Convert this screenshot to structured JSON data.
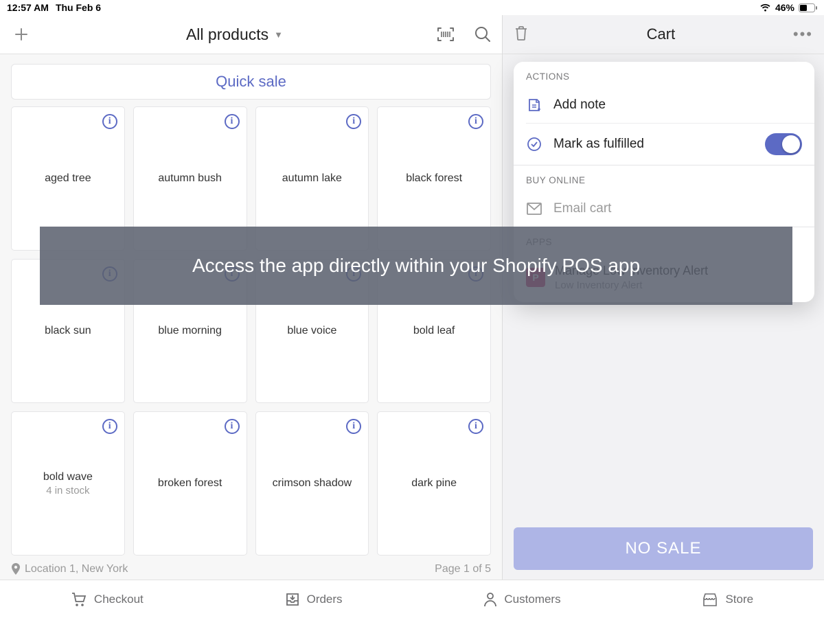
{
  "status": {
    "time": "12:57 AM",
    "date": "Thu Feb 6",
    "battery": "46%"
  },
  "header": {
    "title": "All products"
  },
  "quick_sale": "Quick sale",
  "products": [
    {
      "name": "aged tree"
    },
    {
      "name": "autumn bush"
    },
    {
      "name": "autumn lake"
    },
    {
      "name": "black forest"
    },
    {
      "name": "black sun"
    },
    {
      "name": "blue morning"
    },
    {
      "name": "blue voice"
    },
    {
      "name": "bold leaf"
    },
    {
      "name": "bold wave",
      "stock": "4 in stock"
    },
    {
      "name": "broken forest"
    },
    {
      "name": "crimson shadow"
    },
    {
      "name": "dark pine"
    }
  ],
  "footer": {
    "location": "Location 1, New York",
    "page": "Page 1 of 5"
  },
  "cart": {
    "title": "Cart"
  },
  "popover": {
    "actions_label": "ACTIONS",
    "add_note": "Add note",
    "mark_fulfilled": "Mark as fulfilled",
    "buy_online_label": "BUY ONLINE",
    "email_cart": "Email cart",
    "apps_label": "APPS",
    "app_title": "Manage Low Inventory Alert",
    "app_sub": "Low Inventory Alert"
  },
  "no_sale": "NO SALE",
  "banner": "Access the app directly within your Shopify POS app",
  "nav": {
    "checkout": "Checkout",
    "orders": "Orders",
    "customers": "Customers",
    "store": "Store"
  }
}
